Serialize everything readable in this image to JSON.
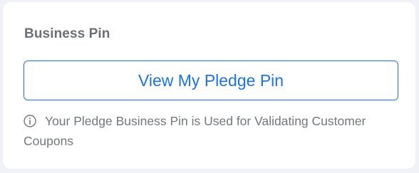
{
  "card": {
    "title": "Business Pin",
    "button_label": "View My Pledge Pin",
    "helper_text": "Your Pledge Business Pin is Used for Validating Customer Coupons",
    "info_icon": "info-circle-icon"
  },
  "colors": {
    "accent": "#1a73e8",
    "title": "#6b6f76",
    "helper": "#73777e",
    "page_bg": "#f1f1f8",
    "card_bg": "#ffffff"
  }
}
